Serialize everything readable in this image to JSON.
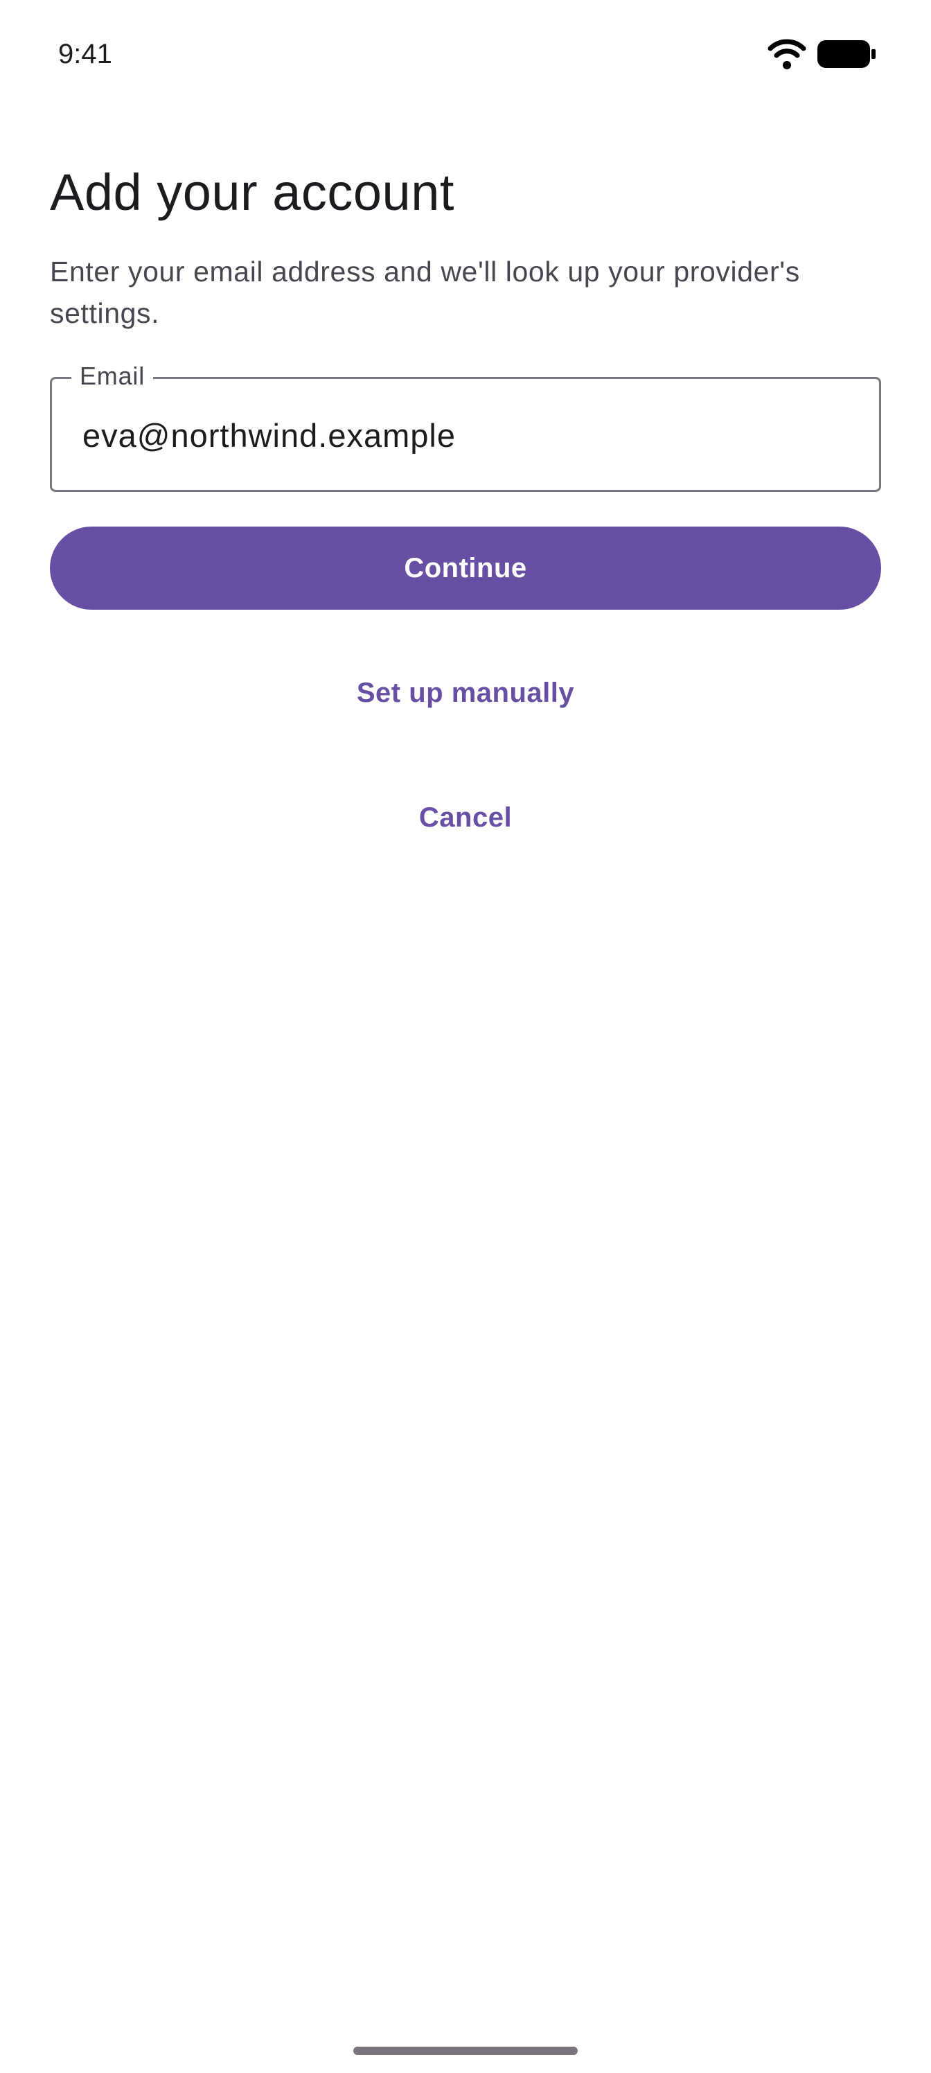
{
  "status_bar": {
    "time": "9:41",
    "wifi_icon": "wifi-icon",
    "battery_icon": "battery-icon"
  },
  "header": {
    "title": "Add your account",
    "subtitle": "Enter your email address and we'll look up your provider's settings."
  },
  "email_field": {
    "label": "Email",
    "value": "eva@northwind.example",
    "type": "email"
  },
  "actions": {
    "continue_label": "Continue",
    "setup_manually_label": "Set up manually",
    "cancel_label": "Cancel"
  },
  "colors": {
    "primary": "#6750A4",
    "on_primary": "#FFFFFF",
    "background": "#FFFFFF",
    "on_surface": "#1C1B1F",
    "on_surface_variant": "#49454F",
    "outline": "#79747E"
  }
}
